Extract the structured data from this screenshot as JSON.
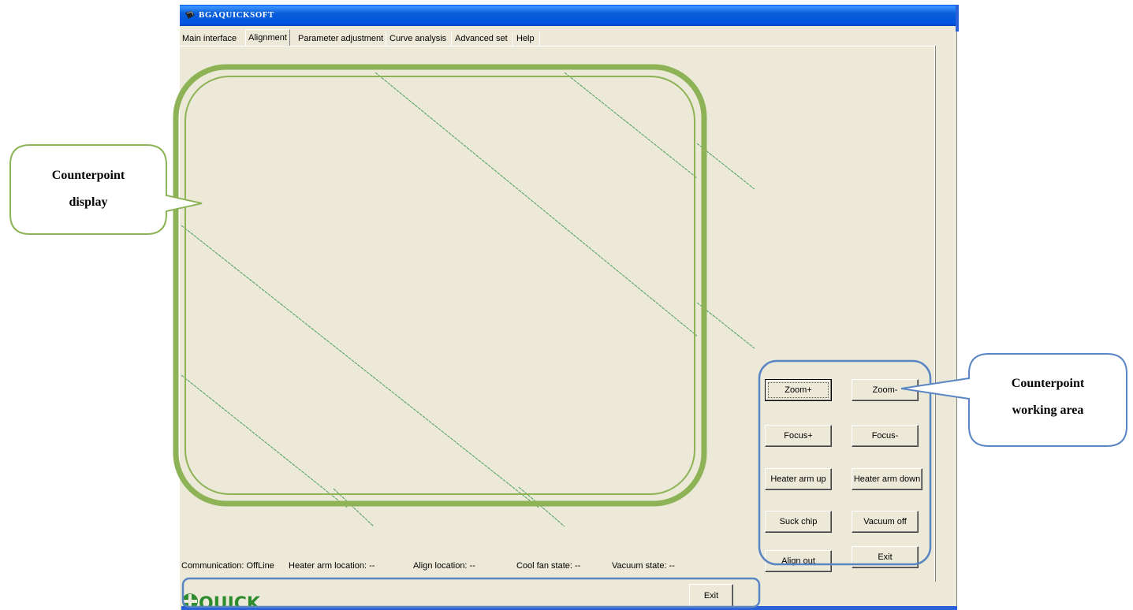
{
  "window": {
    "title": "BGAQUICKSOFT"
  },
  "tabs": [
    {
      "label": "Main interface",
      "active": false
    },
    {
      "label": "Alignment",
      "active": true
    },
    {
      "label": "Parameter adjustment",
      "active": false
    },
    {
      "label": "Curve analysis",
      "active": false
    },
    {
      "label": "Advanced set",
      "active": false
    },
    {
      "label": "Help",
      "active": false
    }
  ],
  "status": {
    "communication": "Communication: OffLine",
    "heater_arm_location": "Heater arm location: --",
    "align_location": "Align  location: --",
    "cool_fan_state": "Cool fan state: --",
    "vacuum_state": "Vacuum state: --"
  },
  "buttons": {
    "zoom_in": "Zoom+",
    "zoom_out": "Zoom-",
    "focus_in": "Focus+",
    "focus_out": "Focus-",
    "heater_arm_up": "Heater arm up",
    "heater_arm_down": "Heater arm down",
    "suck_chip": "Suck chip",
    "vacuum_off": "Vacuum off",
    "align_out": "Align out",
    "exit": "Exit",
    "exit_bottom": "Exit"
  },
  "logo": {
    "text": "QUICK",
    "color": "#2E8B2E"
  },
  "callouts": {
    "display_line1": "Counterpoint",
    "display_line2": "display",
    "working_line1": "Counterpoint",
    "working_line2": "working area"
  },
  "colors": {
    "window_bg": "#ECE9D8",
    "titlebar_blue": "#0054E3",
    "highlight_green": "#8DB356",
    "highlight_blue": "#5B86C4",
    "guide_line_green": "#4C9F5A"
  }
}
